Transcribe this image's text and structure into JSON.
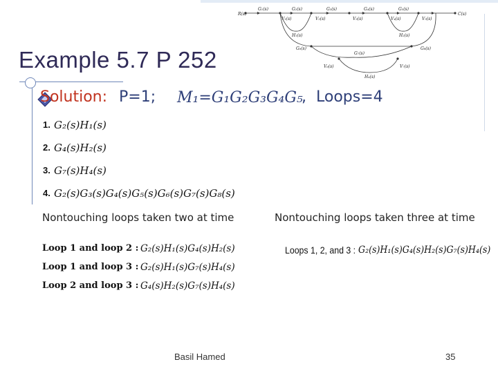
{
  "slide": {
    "title": "Example 5.7 P 252",
    "footer_author": "Basil Hamed",
    "page_number": "35"
  },
  "solution": {
    "label": "Solution:",
    "p_value": "P=1;",
    "forward_path": "M₁=G₁G₂G₃G₄G₅",
    "comma": ",",
    "loops_count": "Loops=4"
  },
  "loops": [
    {
      "num": "1.",
      "expr": "G₂(s)H₁(s)"
    },
    {
      "num": "2.",
      "expr": "G₄(s)H₂(s)"
    },
    {
      "num": "3.",
      "expr": "G₇(s)H₄(s)"
    },
    {
      "num": "4.",
      "expr": "G₂(s)G₃(s)G₄(s)G₅(s)G₆(s)G₇(s)G₈(s)"
    }
  ],
  "nontouching_two": {
    "heading": "Nontouching loops taken two at time",
    "rows": [
      {
        "label": "Loop 1 and loop 2 :",
        "expr": "G₂(s)H₁(s)G₄(s)H₂(s)"
      },
      {
        "label": "Loop 1 and loop 3 :",
        "expr": "G₂(s)H₁(s)G₇(s)H₄(s)"
      },
      {
        "label": "Loop 2 and loop 3 :",
        "expr": "G₄(s)H₂(s)G₇(s)H₄(s)"
      }
    ]
  },
  "nontouching_three": {
    "heading": "Nontouching loops taken three at time",
    "label": "Loops 1, 2, and 3 :",
    "expr": "G₂(s)H₁(s)G₄(s)H₂(s)G₇(s)H₄(s)"
  },
  "diagram": {
    "forward": [
      "R(s)",
      "G₁(s)",
      "V₁(s)",
      "G₂(s)",
      "V₂(s)",
      "G₃(s)",
      "V₃(s)",
      "G₄(s)",
      "V₄(s)",
      "G₅(s)",
      "V₅(s)",
      "C(s)"
    ],
    "h1": "H₁(s)",
    "h2": "H₂(s)",
    "g6": "G₆(s)",
    "g8": "G₈(s)",
    "g7": "G₇(s)",
    "v6": "V₆(s)",
    "v7": "V₇(s)",
    "h4": "H₄(s)"
  },
  "colors": {
    "title": "#2f2a57",
    "solution_label": "#c1331f",
    "equation": "#2e3f78",
    "frame": "#6f87b8"
  }
}
